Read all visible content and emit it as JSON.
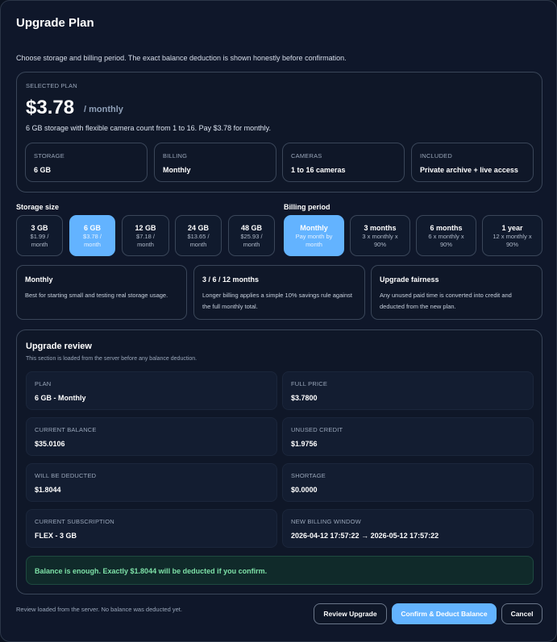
{
  "modal": {
    "title": "Upgrade Plan",
    "intro": "Choose storage and billing period. The exact balance deduction is shown honestly before confirmation."
  },
  "selected_plan": {
    "label": "SELECTED PLAN",
    "price": "$3.78",
    "per": "/ monthly",
    "description": "6 GB storage with flexible camera count from 1 to 16. Pay $3.78 for monthly.",
    "stats": [
      {
        "label": "STORAGE",
        "value": "6 GB"
      },
      {
        "label": "BILLING",
        "value": "Monthly"
      },
      {
        "label": "CAMERAS",
        "value": "1 to 16 cameras"
      },
      {
        "label": "INCLUDED",
        "value": "Private archive + live access"
      }
    ]
  },
  "storage": {
    "heading": "Storage size",
    "options": [
      {
        "main": "3 GB",
        "sub1": "$1.99 /",
        "sub2": "month"
      },
      {
        "main": "6 GB",
        "sub1": "$3.78 /",
        "sub2": "month"
      },
      {
        "main": "12 GB",
        "sub1": "$7.18 /",
        "sub2": "month"
      },
      {
        "main": "24 GB",
        "sub1": "$13.65 /",
        "sub2": "month"
      },
      {
        "main": "48 GB",
        "sub1": "$25.93 /",
        "sub2": "month"
      }
    ],
    "selected": "6 GB"
  },
  "billing": {
    "heading": "Billing period",
    "options": [
      {
        "main": "Monthly",
        "sub1": "Pay month by",
        "sub2": "month"
      },
      {
        "main": "3 months",
        "sub1": "3 x monthly x",
        "sub2": "90%"
      },
      {
        "main": "6 months",
        "sub1": "6 x monthly x",
        "sub2": "90%"
      },
      {
        "main": "1 year",
        "sub1": "12 x monthly x",
        "sub2": "90%"
      }
    ],
    "selected": "Monthly"
  },
  "info_cards": [
    {
      "title": "Monthly",
      "text": "Best for starting small and testing real storage usage."
    },
    {
      "title": "3 / 6 / 12 months",
      "text": "Longer billing applies a simple 10% savings rule against the full monthly total."
    },
    {
      "title": "Upgrade fairness",
      "text": "Any unused paid time is converted into credit and deducted from the new plan."
    }
  ],
  "review": {
    "title": "Upgrade review",
    "subtitle": "This section is loaded from the server before any balance deduction.",
    "cells": [
      {
        "label": "PLAN",
        "value": "6 GB - Monthly"
      },
      {
        "label": "FULL PRICE",
        "value": "$3.7800"
      },
      {
        "label": "CURRENT BALANCE",
        "value": "$35.0106"
      },
      {
        "label": "UNUSED CREDIT",
        "value": "$1.9756"
      },
      {
        "label": "WILL BE DEDUCTED",
        "value": "$1.8044"
      },
      {
        "label": "SHORTAGE",
        "value": "$0.0000"
      },
      {
        "label": "CURRENT SUBSCRIPTION",
        "value": "FLEX - 3 GB"
      },
      {
        "label": "NEW BILLING WINDOW",
        "value": "2026-04-12 17:57:22 → 2026-05-12 17:57:22"
      }
    ],
    "notice": "Balance is enough. Exactly $1.8044 will be deducted if you confirm."
  },
  "footer": {
    "note": "Review loaded from the server. No balance was deducted yet.",
    "review_button": "Review Upgrade",
    "confirm_button": "Confirm & Deduct Balance",
    "cancel_button": "Cancel"
  },
  "colors": {
    "accent": "#63b3ff",
    "background": "#0f172a",
    "success_text": "#7ee2a8"
  }
}
